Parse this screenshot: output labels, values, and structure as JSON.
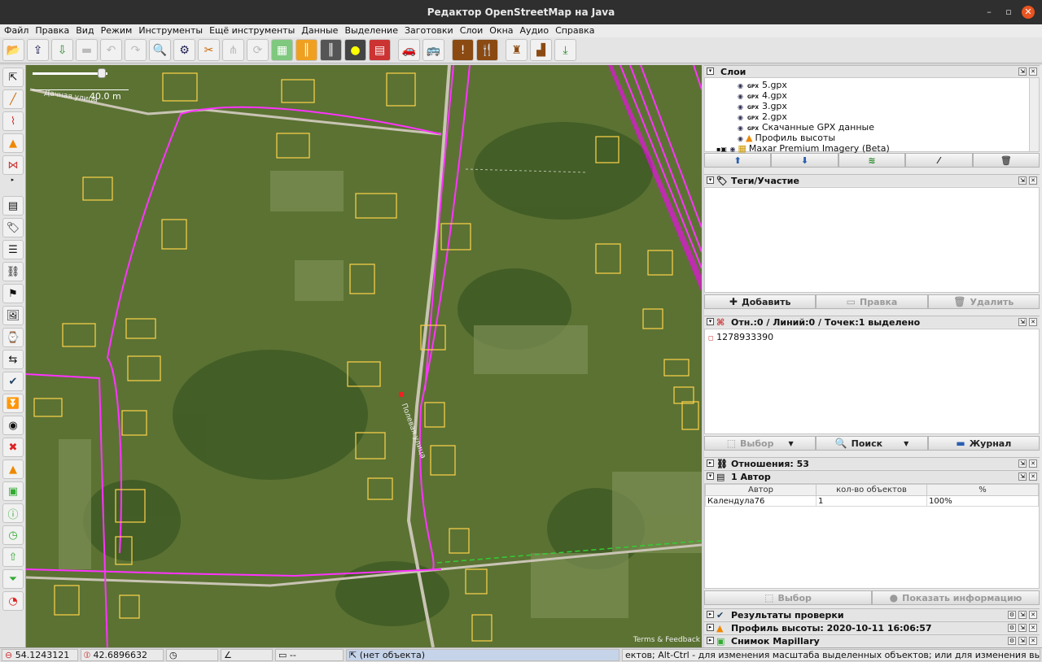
{
  "window": {
    "title": "Редактор OpenStreetMap на Java"
  },
  "menu": [
    "Файл",
    "Правка",
    "Вид",
    "Режим",
    "Инструменты",
    "Ещё инструменты",
    "Данные",
    "Выделение",
    "Заготовки",
    "Слои",
    "Окна",
    "Аудио",
    "Справка"
  ],
  "toolbar": {
    "icons": [
      "open-icon",
      "upload-icon",
      "download-icon",
      "save-icon",
      "undo-icon",
      "redo-icon",
      "search-icon",
      "preferences-icon",
      "split-way-icon",
      "combine-icon",
      "refresh-icon",
      "buildings-icon",
      "road-icon",
      "road-alt-icon",
      "traffic-light-icon",
      "brick-icon",
      "car-icon",
      "bus-icon",
      "warning-icon",
      "restaurant-icon",
      "castle-icon",
      "factory-icon",
      "map-import-icon"
    ]
  },
  "map": {
    "scale_label": "40.0 m",
    "street_label_1": "Дачная улица",
    "street_label_2": "Полевая улица",
    "attribution": "Terms & Feedback"
  },
  "layers": {
    "title": "Слои",
    "items": [
      {
        "name": "5.gpx",
        "type": "GPX"
      },
      {
        "name": "4.gpx",
        "type": "GPX"
      },
      {
        "name": "3.gpx",
        "type": "GPX"
      },
      {
        "name": "2.gpx",
        "type": "GPX"
      },
      {
        "name": "Скачанные GPX данные",
        "type": "GPX"
      },
      {
        "name": "Профиль высоты",
        "type": "elevation"
      },
      {
        "name": "Maxar Premium Imagery (Beta)",
        "type": "imagery"
      }
    ]
  },
  "tags": {
    "title": "Теги/Участие",
    "add": "Добавить",
    "edit": "Правка",
    "delete": "Удалить"
  },
  "selection": {
    "title": "Отн.:0 / Линий:0 / Точек:1 выделено",
    "item": "1278933390",
    "select": "Выбор",
    "search": "Поиск",
    "history": "Журнал"
  },
  "relations": {
    "title": "Отношения: 53"
  },
  "authors": {
    "title": "1 Автор",
    "headers": [
      "Автор",
      "кол-во объектов",
      "%"
    ],
    "rows": [
      [
        "Календула76",
        "1",
        "100%"
      ]
    ],
    "select": "Выбор",
    "info": "Показать информацию"
  },
  "validation": {
    "title": "Результаты проверки"
  },
  "elevation": {
    "title": "Профиль высоты: 2020-10-11 16:06:57"
  },
  "mapillary": {
    "title": "Снимок Mapillary"
  },
  "status": {
    "lat": "54.1243121",
    "lon": "42.6896632",
    "heading": "",
    "angle": "",
    "length": "--",
    "object": "(нет объекта)",
    "hint": "ектов; Alt-Ctrl - для изменения масштаба выделенных объектов; или для изменения выделения"
  }
}
